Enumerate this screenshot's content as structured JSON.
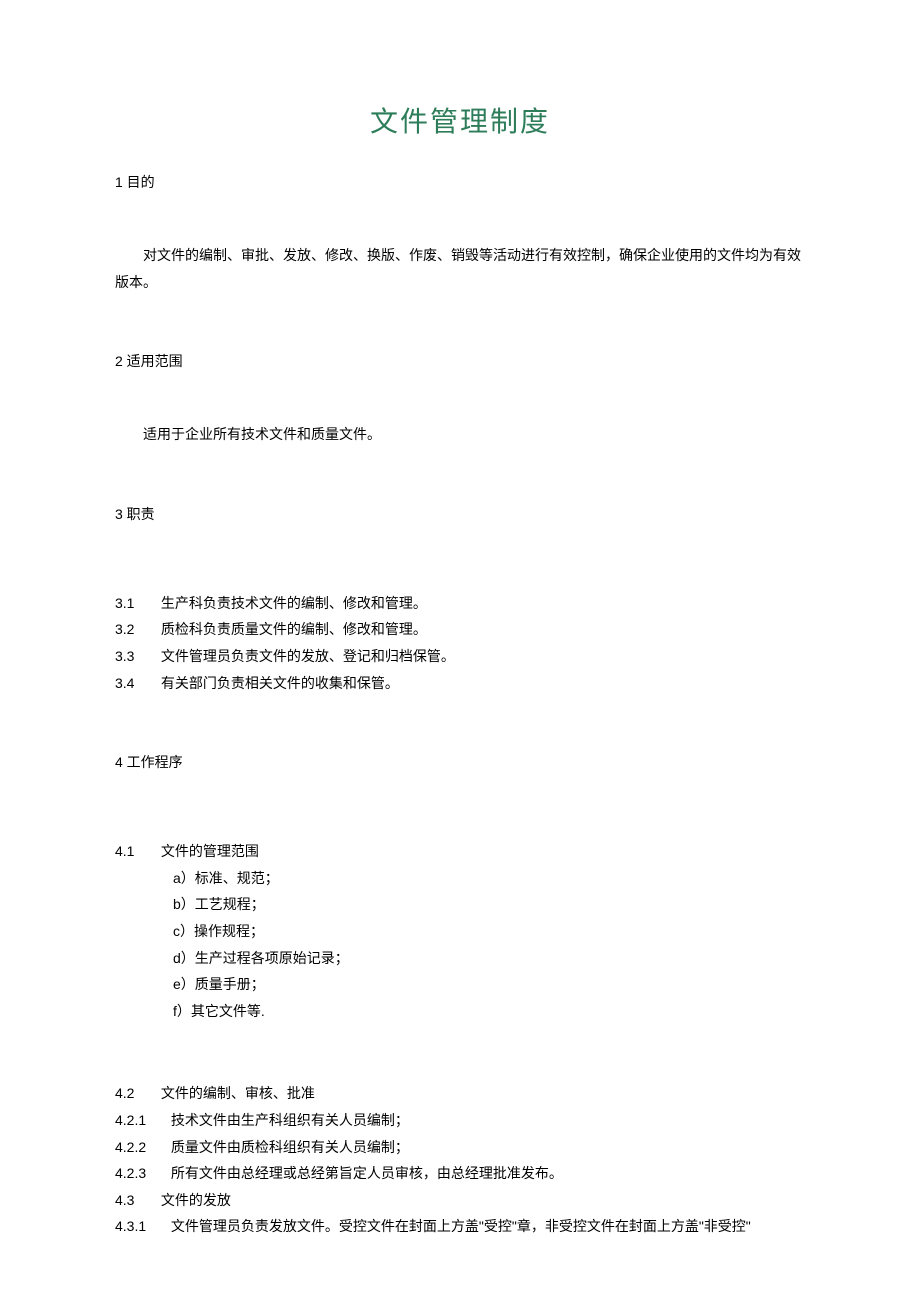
{
  "title": "文件管理制度",
  "sections": {
    "purpose": {
      "heading": "1 目的",
      "body": "对文件的编制、审批、发放、修改、换版、作废、销毁等活动进行有效控制，确保企业使用的文件均为有效版本。"
    },
    "scope": {
      "heading": "2 适用范围",
      "body": "适用于企业所有技术文件和质量文件。"
    },
    "responsibility": {
      "heading": "3 职责",
      "items": [
        {
          "num": "3.1",
          "text": "生产科负责技术文件的编制、修改和管理。"
        },
        {
          "num": "3.2",
          "text": "质检科负责质量文件的编制、修改和管理。"
        },
        {
          "num": "3.3",
          "text": "文件管理员负责文件的发放、登记和归档保管。"
        },
        {
          "num": "3.4",
          "text": "有关部门负责相关文件的收集和保管。"
        }
      ]
    },
    "procedure": {
      "heading": "4 工作程序",
      "section41": {
        "num": "4.1",
        "title": "文件的管理范围",
        "items": [
          "a）标准、规范；",
          "b）工艺规程；",
          "c）操作规程；",
          "d）生产过程各项原始记录；",
          "e）质量手册；",
          "f）其它文件等."
        ]
      },
      "section42": {
        "num": "4.2",
        "title": "文件的编制、审核、批准",
        "subitems": [
          {
            "num": "4.2.1",
            "text": "技术文件由生产科组织有关人员编制；"
          },
          {
            "num": "4.2.2",
            "text": "质量文件由质检科组织有关人员编制；"
          },
          {
            "num": "4.2.3",
            "text": "所有文件由总经理或总经第旨定人员审核，由总经理批准发布。"
          }
        ]
      },
      "section43": {
        "num": "4.3",
        "title": "文件的发放",
        "subitems": [
          {
            "num": "4.3.1",
            "text": "文件管理员负责发放文件。受控文件在封面上方盖\"受控\"章，非受控文件在封面上方盖\"非受控\""
          }
        ]
      }
    }
  }
}
